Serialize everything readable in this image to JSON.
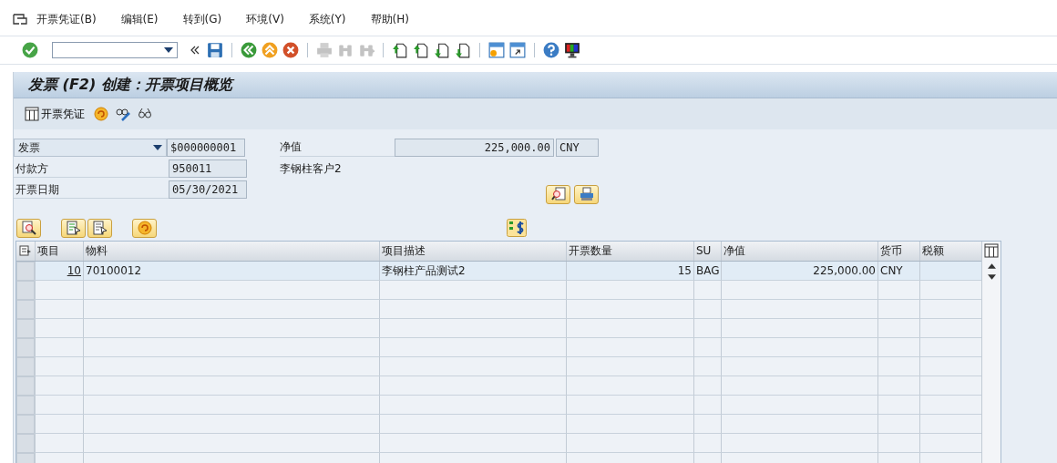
{
  "menu": [
    {
      "label": "开票凭证(B)"
    },
    {
      "label": "编辑(E)"
    },
    {
      "label": "转到(G)"
    },
    {
      "label": "环境(V)"
    },
    {
      "label": "系统(Y)"
    },
    {
      "label": "帮助(H)"
    }
  ],
  "toolbar": {
    "groups": [
      [
        {
          "kind": "save",
          "disabled": false
        }
      ],
      [
        {
          "kind": "back",
          "disabled": false
        },
        {
          "kind": "exit",
          "disabled": false
        },
        {
          "kind": "cancel",
          "disabled": false
        }
      ],
      [
        {
          "kind": "print",
          "disabled": true
        },
        {
          "kind": "find",
          "disabled": true
        },
        {
          "kind": "find-next",
          "disabled": true
        }
      ],
      [
        {
          "kind": "first-page",
          "disabled": false
        },
        {
          "kind": "prev-page",
          "disabled": false
        },
        {
          "kind": "next-page",
          "disabled": false
        },
        {
          "kind": "last-page",
          "disabled": false
        }
      ],
      [
        {
          "kind": "new-session",
          "disabled": false
        },
        {
          "kind": "shortcut",
          "disabled": false
        }
      ],
      [
        {
          "kind": "help",
          "disabled": false
        },
        {
          "kind": "layout",
          "disabled": false
        }
      ]
    ]
  },
  "title": "发票 (F2) 创建：开票项目概览",
  "app_toolbar": [
    {
      "kind": "document",
      "label": "开票凭证"
    },
    {
      "kind": "pricing"
    },
    {
      "kind": "edit-glasses"
    },
    {
      "kind": "glasses"
    }
  ],
  "header": {
    "billing_type": "发票",
    "document_number": "$000000001",
    "payer_label": "付款方",
    "payer": "950011",
    "payer_name": "李钢柱客户2",
    "date_label": "开票日期",
    "date": "05/30/2021",
    "net_value_label": "净值",
    "net_value": "225,000.00",
    "currency": "CNY"
  },
  "header_buttons": [
    {
      "kind": "display-doc"
    },
    {
      "kind": "output"
    }
  ],
  "table_buttons": [
    {
      "kind": "details"
    },
    {
      "kind": "select-all"
    },
    {
      "kind": "deselect-all"
    },
    {
      "kind": "pricing"
    }
  ],
  "table": {
    "columns": [
      "项目",
      "物料",
      "项目描述",
      "开票数量",
      "SU",
      "净值",
      "货币",
      "税额"
    ],
    "rows": [
      {
        "selected": false,
        "cells": [
          "10",
          "70100012",
          "李钢柱产品测试2",
          "15",
          "BAG",
          "225,000.00",
          "CNY",
          ""
        ]
      }
    ]
  }
}
